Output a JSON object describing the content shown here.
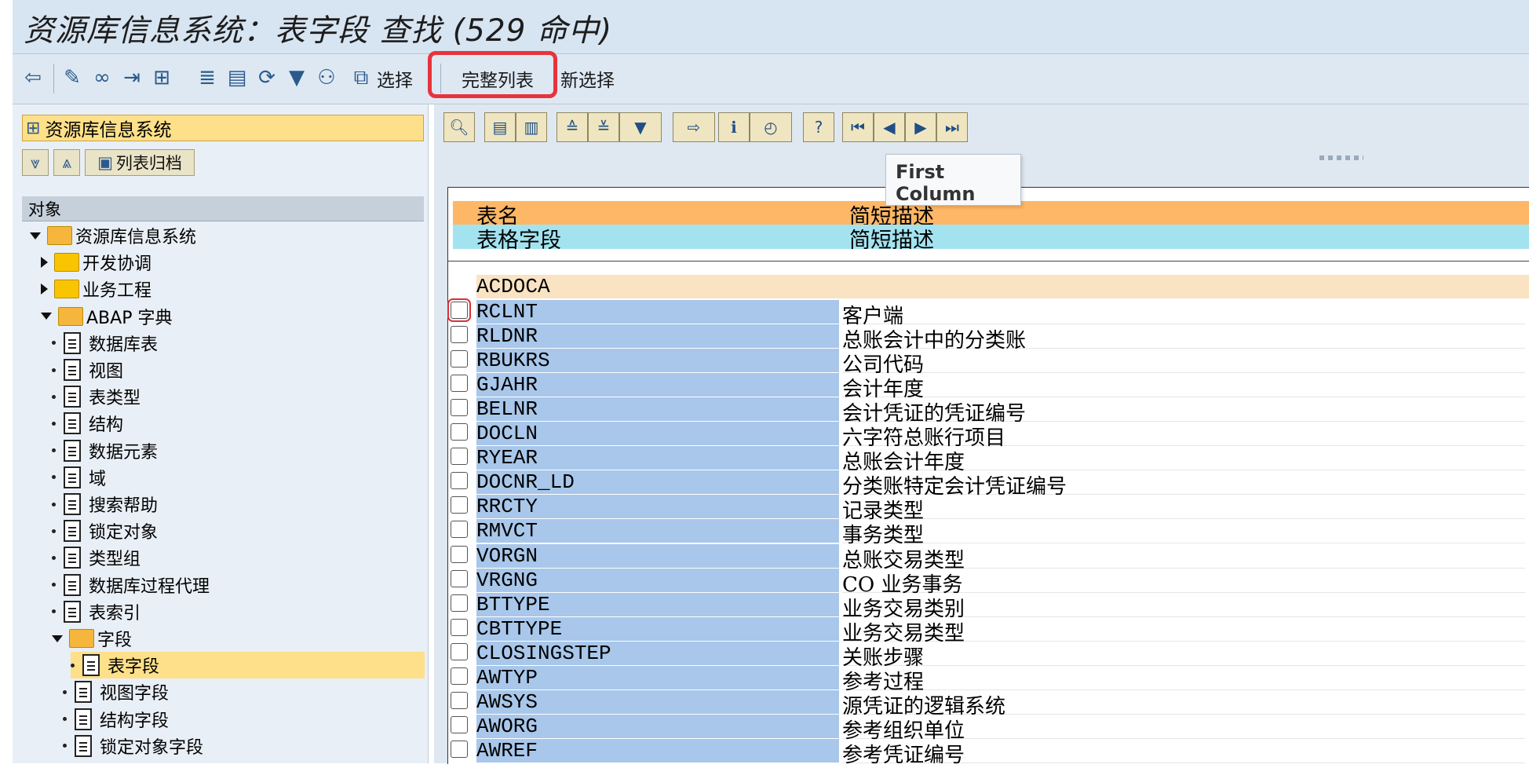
{
  "window": {
    "title": "资源库信息系统：表字段 查找 (529 命中)"
  },
  "toolbar": {
    "icons": [
      "back-icon",
      "edit-icon",
      "glasses-icon",
      "move-icon",
      "hierarchy-icon",
      "align-icon",
      "table-icon",
      "refresh-icon",
      "filter-icon",
      "binoculars-icon",
      "select-icon"
    ],
    "select_label": "选择",
    "full_list_label": "完整列表",
    "new_selection_label": "新选择"
  },
  "left_pane": {
    "header_label": "资源库信息系统",
    "archive_button_label": "列表归档",
    "objects_label": "对象",
    "tree": [
      {
        "label": "资源库信息系统",
        "level": 0,
        "type": "folder-open"
      },
      {
        "label": "开发协调",
        "level": 1,
        "type": "folder"
      },
      {
        "label": "业务工程",
        "level": 1,
        "type": "folder"
      },
      {
        "label": "ABAP 字典",
        "level": 1,
        "type": "folder-open"
      },
      {
        "label": "数据库表",
        "level": 2,
        "type": "doc"
      },
      {
        "label": "视图",
        "level": 2,
        "type": "doc"
      },
      {
        "label": "表类型",
        "level": 2,
        "type": "doc"
      },
      {
        "label": "结构",
        "level": 2,
        "type": "doc"
      },
      {
        "label": "数据元素",
        "level": 2,
        "type": "doc"
      },
      {
        "label": "域",
        "level": 2,
        "type": "doc"
      },
      {
        "label": "搜索帮助",
        "level": 2,
        "type": "doc"
      },
      {
        "label": "锁定对象",
        "level": 2,
        "type": "doc"
      },
      {
        "label": "类型组",
        "level": 2,
        "type": "doc"
      },
      {
        "label": "数据库过程代理",
        "level": 2,
        "type": "doc"
      },
      {
        "label": "表索引",
        "level": 2,
        "type": "doc"
      },
      {
        "label": "字段",
        "level": 2,
        "type": "folder-open"
      },
      {
        "label": "表字段",
        "level": 3,
        "type": "doc",
        "selected": true
      },
      {
        "label": "视图字段",
        "level": 3,
        "type": "doc"
      },
      {
        "label": "结构字段",
        "level": 3,
        "type": "doc"
      },
      {
        "label": "锁定对象字段",
        "level": 3,
        "type": "doc"
      }
    ]
  },
  "right_pane": {
    "tooltip": "First Column",
    "header": {
      "table_name": "表名",
      "short_desc": "简短描述",
      "table_field": "表格字段",
      "short_desc2": "简短描述"
    },
    "table_group": "ACDOCA",
    "rows": [
      {
        "field": "RCLNT",
        "desc": "客户端"
      },
      {
        "field": "RLDNR",
        "desc": "总账会计中的分类账"
      },
      {
        "field": "RBUKRS",
        "desc": "公司代码"
      },
      {
        "field": "GJAHR",
        "desc": "会计年度"
      },
      {
        "field": "BELNR",
        "desc": "会计凭证的凭证编号"
      },
      {
        "field": "DOCLN",
        "desc": "六字符总账行项目"
      },
      {
        "field": "RYEAR",
        "desc": "总账会计年度"
      },
      {
        "field": "DOCNR_LD",
        "desc": "分类账特定会计凭证编号"
      },
      {
        "field": "RRCTY",
        "desc": "记录类型"
      },
      {
        "field": "RMVCT",
        "desc": "事务类型"
      },
      {
        "field": "VORGN",
        "desc": "总账交易类型"
      },
      {
        "field": "VRGNG",
        "desc": "CO 业务事务"
      },
      {
        "field": "BTTYPE",
        "desc": "业务交易类别"
      },
      {
        "field": "CBTTYPE",
        "desc": "业务交易类型"
      },
      {
        "field": "CLOSINGSTEP",
        "desc": "关账步骤"
      },
      {
        "field": "AWTYP",
        "desc": "参考过程"
      },
      {
        "field": "AWSYS",
        "desc": "源凭证的逻辑系统"
      },
      {
        "field": "AWORG",
        "desc": "参考组织单位"
      },
      {
        "field": "AWREF",
        "desc": "参考凭证编号"
      }
    ]
  }
}
